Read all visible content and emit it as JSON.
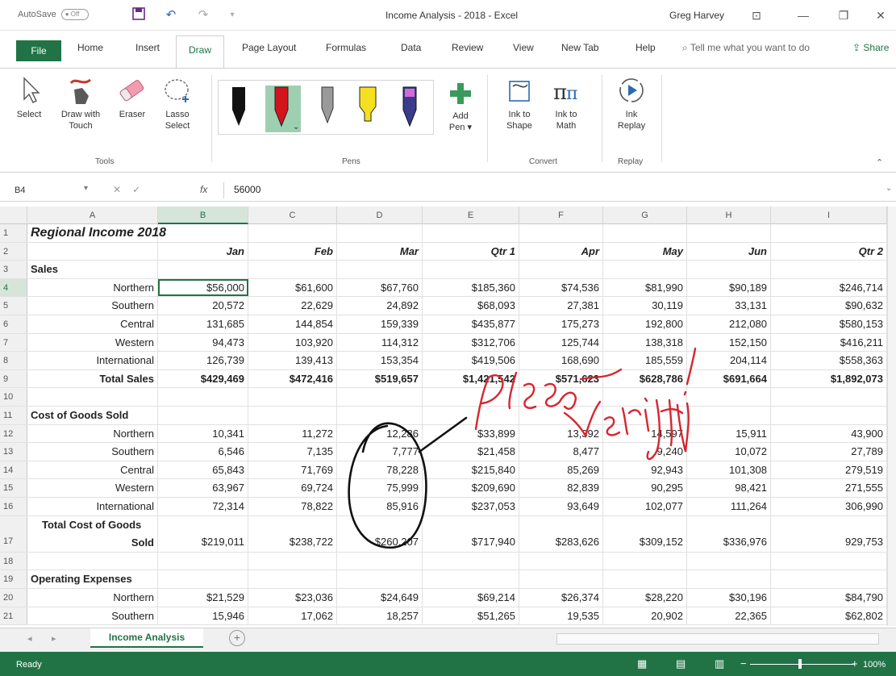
{
  "window": {
    "autosave_label": "AutoSave",
    "autosave_state": "Off",
    "title": "Income Analysis - 2018 - Excel",
    "user": "Greg Harvey"
  },
  "tabs": [
    "Home",
    "Insert",
    "Draw",
    "Page Layout",
    "Formulas",
    "Data",
    "Review",
    "View",
    "New Tab",
    "Help"
  ],
  "file_tab": "File",
  "tell_me": "Tell me what you want to do",
  "share": "Share",
  "ribbon": {
    "tools": {
      "select": "Select",
      "draw_with_touch_1": "Draw with",
      "draw_with_touch_2": "Touch",
      "eraser": "Eraser",
      "lasso_1": "Lasso",
      "lasso_2": "Select",
      "group": "Tools"
    },
    "pens": {
      "group": "Pens",
      "add_pen_1": "Add",
      "add_pen_2": "Pen ▾"
    },
    "convert": {
      "ink_to_shape_1": "Ink to",
      "ink_to_shape_2": "Shape",
      "ink_to_math_1": "Ink to",
      "ink_to_math_2": "Math",
      "group": "Convert"
    },
    "replay": {
      "ink_replay_1": "Ink",
      "ink_replay_2": "Replay",
      "group": "Replay"
    }
  },
  "formula_bar": {
    "name_box": "B4",
    "fx": "fx",
    "value": "56000"
  },
  "columns": [
    "A",
    "B",
    "C",
    "D",
    "E",
    "F",
    "G",
    "H",
    "I"
  ],
  "rows": [
    {
      "n": "1",
      "a": "Regional Income 2018",
      "v": [
        "",
        "",
        "",
        "",
        "",
        "",
        "",
        ""
      ],
      "kind": "title"
    },
    {
      "n": "2",
      "a": "",
      "v": [
        "Jan",
        "Feb",
        "Mar",
        "Qtr 1",
        "Apr",
        "May",
        "Jun",
        "Qtr 2"
      ],
      "kind": "header"
    },
    {
      "n": "3",
      "a": "Sales",
      "v": [
        "",
        "",
        "",
        "",
        "",
        "",
        "",
        ""
      ],
      "kind": "section"
    },
    {
      "n": "4",
      "a": "Northern",
      "v": [
        "$56,000",
        "$61,600",
        "$67,760",
        "$185,360",
        "$74,536",
        "$81,990",
        "$90,189",
        "$246,714"
      ],
      "kind": "data"
    },
    {
      "n": "5",
      "a": "Southern",
      "v": [
        "20,572",
        "22,629",
        "24,892",
        "$68,093",
        "27,381",
        "30,119",
        "33,131",
        "$90,632"
      ],
      "kind": "data"
    },
    {
      "n": "6",
      "a": "Central",
      "v": [
        "131,685",
        "144,854",
        "159,339",
        "$435,877",
        "175,273",
        "192,800",
        "212,080",
        "$580,153"
      ],
      "kind": "data"
    },
    {
      "n": "7",
      "a": "Western",
      "v": [
        "94,473",
        "103,920",
        "114,312",
        "$312,706",
        "125,744",
        "138,318",
        "152,150",
        "$416,211"
      ],
      "kind": "data"
    },
    {
      "n": "8",
      "a": "International",
      "v": [
        "126,739",
        "139,413",
        "153,354",
        "$419,506",
        "168,690",
        "185,559",
        "204,114",
        "$558,363"
      ],
      "kind": "data"
    },
    {
      "n": "9",
      "a": "Total Sales",
      "v": [
        "$429,469",
        "$472,416",
        "$519,657",
        "$1,421,542",
        "$571,623",
        "$628,786",
        "$691,664",
        "$1,892,073"
      ],
      "kind": "total"
    },
    {
      "n": "10",
      "a": "",
      "v": [
        "",
        "",
        "",
        "",
        "",
        "",
        "",
        ""
      ],
      "kind": "data"
    },
    {
      "n": "11",
      "a": "Cost of Goods Sold",
      "v": [
        "",
        "",
        "",
        "",
        "",
        "",
        "",
        ""
      ],
      "kind": "section"
    },
    {
      "n": "12",
      "a": "Northern",
      "v": [
        "10,341",
        "11,272",
        "12,286",
        "$33,899",
        "13,392",
        "14,597",
        "15,911",
        "43,900"
      ],
      "kind": "data"
    },
    {
      "n": "13",
      "a": "Southern",
      "v": [
        "6,546",
        "7,135",
        "7,777",
        "$21,458",
        "8,477",
        "9,240",
        "10,072",
        "27,789"
      ],
      "kind": "data"
    },
    {
      "n": "14",
      "a": "Central",
      "v": [
        "65,843",
        "71,769",
        "78,228",
        "$215,840",
        "85,269",
        "92,943",
        "101,308",
        "279,519"
      ],
      "kind": "data"
    },
    {
      "n": "15",
      "a": "Western",
      "v": [
        "63,967",
        "69,724",
        "75,999",
        "$209,690",
        "82,839",
        "90,295",
        "98,421",
        "271,555"
      ],
      "kind": "data"
    },
    {
      "n": "16",
      "a": "International",
      "v": [
        "72,314",
        "78,822",
        "85,916",
        "$237,053",
        "93,649",
        "102,077",
        "111,264",
        "306,990"
      ],
      "kind": "data"
    },
    {
      "n": "17",
      "a": "Sold",
      "a_top": "Total Cost of Goods",
      "v": [
        "$219,011",
        "$238,722",
        "$260,207",
        "$717,940",
        "$283,626",
        "$309,152",
        "$336,976",
        "929,753"
      ],
      "kind": "total2"
    },
    {
      "n": "18",
      "a": "",
      "v": [
        "",
        "",
        "",
        "",
        "",
        "",
        "",
        ""
      ],
      "kind": "data"
    },
    {
      "n": "19",
      "a": "Operating Expenses",
      "v": [
        "",
        "",
        "",
        "",
        "",
        "",
        "",
        ""
      ],
      "kind": "section"
    },
    {
      "n": "20",
      "a": "Northern",
      "v": [
        "$21,529",
        "$23,036",
        "$24,649",
        "$69,214",
        "$26,374",
        "$28,220",
        "$30,196",
        "$84,790"
      ],
      "kind": "data"
    },
    {
      "n": "21",
      "a": "Southern",
      "v": [
        "15,946",
        "17,062",
        "18,257",
        "$51,265",
        "19,535",
        "20,902",
        "22,365",
        "$62,802"
      ],
      "kind": "data"
    }
  ],
  "sheet_tab": "Income Analysis",
  "status": {
    "ready": "Ready",
    "zoom": "100%"
  }
}
